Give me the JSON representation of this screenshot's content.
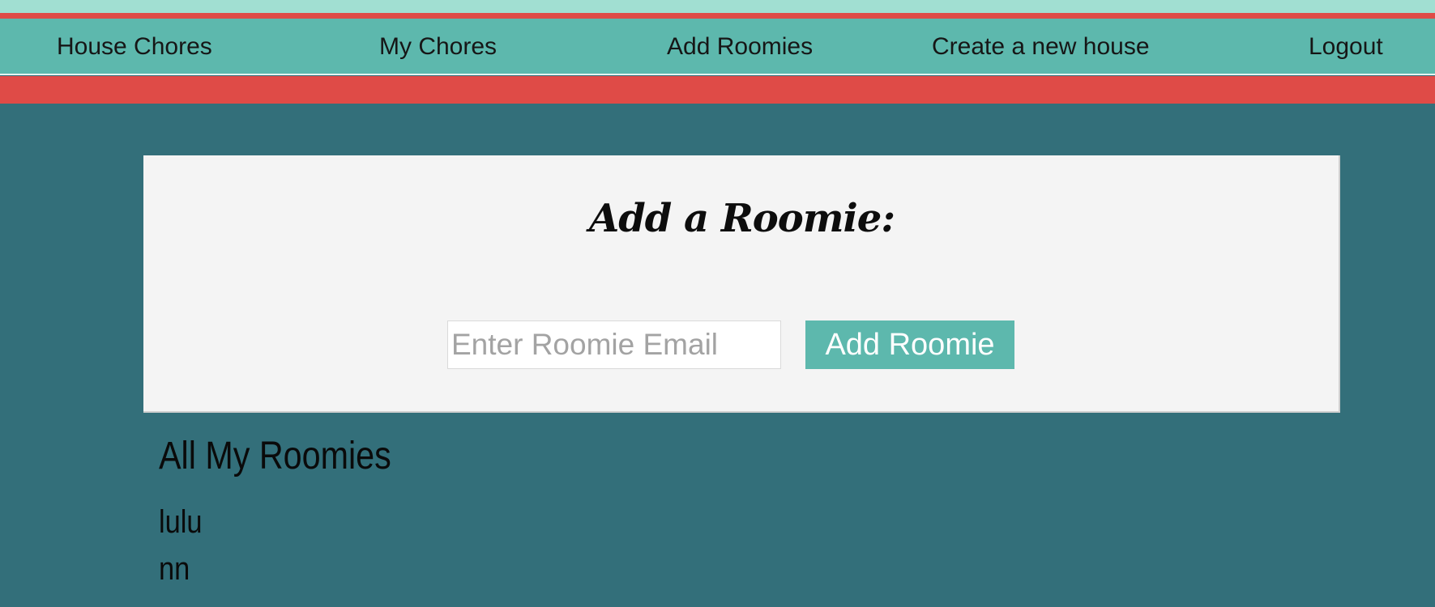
{
  "nav": {
    "house_chores": "House Chores",
    "my_chores": "My Chores",
    "add_roomies": "Add Roomies",
    "create_house": "Create a new house",
    "logout": "Logout"
  },
  "card": {
    "title": "Add a Roomie:",
    "email_placeholder": "Enter Roomie Email",
    "email_value": "",
    "add_button": "Add Roomie"
  },
  "roomies": {
    "heading": "All My Roomies",
    "items": [
      "lulu",
      "nn"
    ]
  },
  "colors": {
    "teal": "#5db8ad",
    "light_teal": "#a1dfd2",
    "red": "#df4b47",
    "background": "#336f7a",
    "card": "#f4f4f4"
  }
}
